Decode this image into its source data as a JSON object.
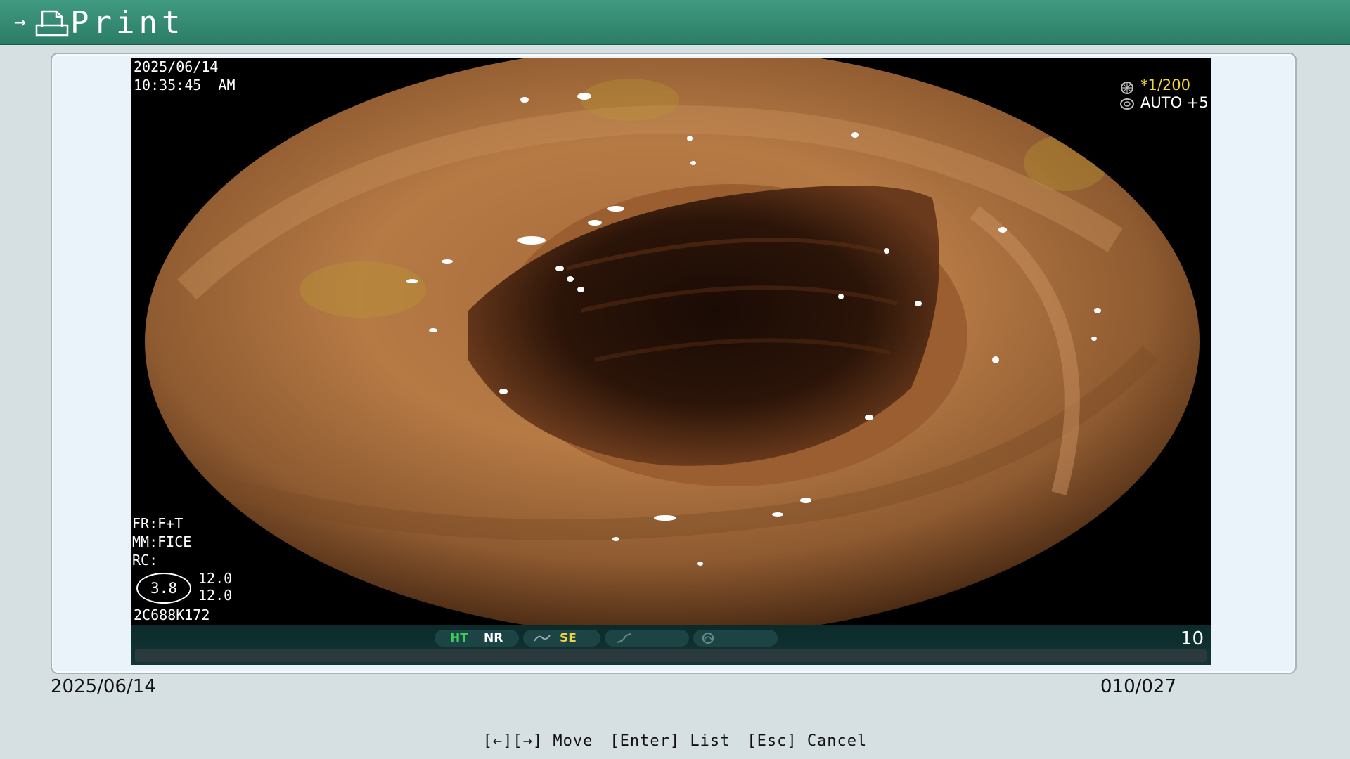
{
  "window": {
    "title": "Print",
    "arrow_glyph": "→"
  },
  "osd": {
    "date": "2025/06/14",
    "time": "10:35:45  AM",
    "shutter": "*1/200",
    "exposure": "AUTO +5",
    "fr": "FR:F+T",
    "mm": "MM:FICE",
    "rc": "RC:",
    "badge_value": "3.8",
    "zoom_top": "12.0",
    "zoom_bottom": "12.0",
    "serial": "2C688K172"
  },
  "status_bar": {
    "ht": "HT",
    "nr": "NR",
    "se": "SE",
    "counter": "10",
    "colors": {
      "ht": "#3cd05a",
      "nr": "#ffffff",
      "se": "#f0d640"
    }
  },
  "info": {
    "date": "2025/06/14",
    "index": "010/027"
  },
  "help": {
    "move": "[←][→] Move",
    "list": "[Enter] List",
    "cancel": "[Esc] Cancel"
  },
  "colors": {
    "titlebar": "#2c7d66",
    "background": "#d6e0e2",
    "panel": "#eaf3f9"
  }
}
